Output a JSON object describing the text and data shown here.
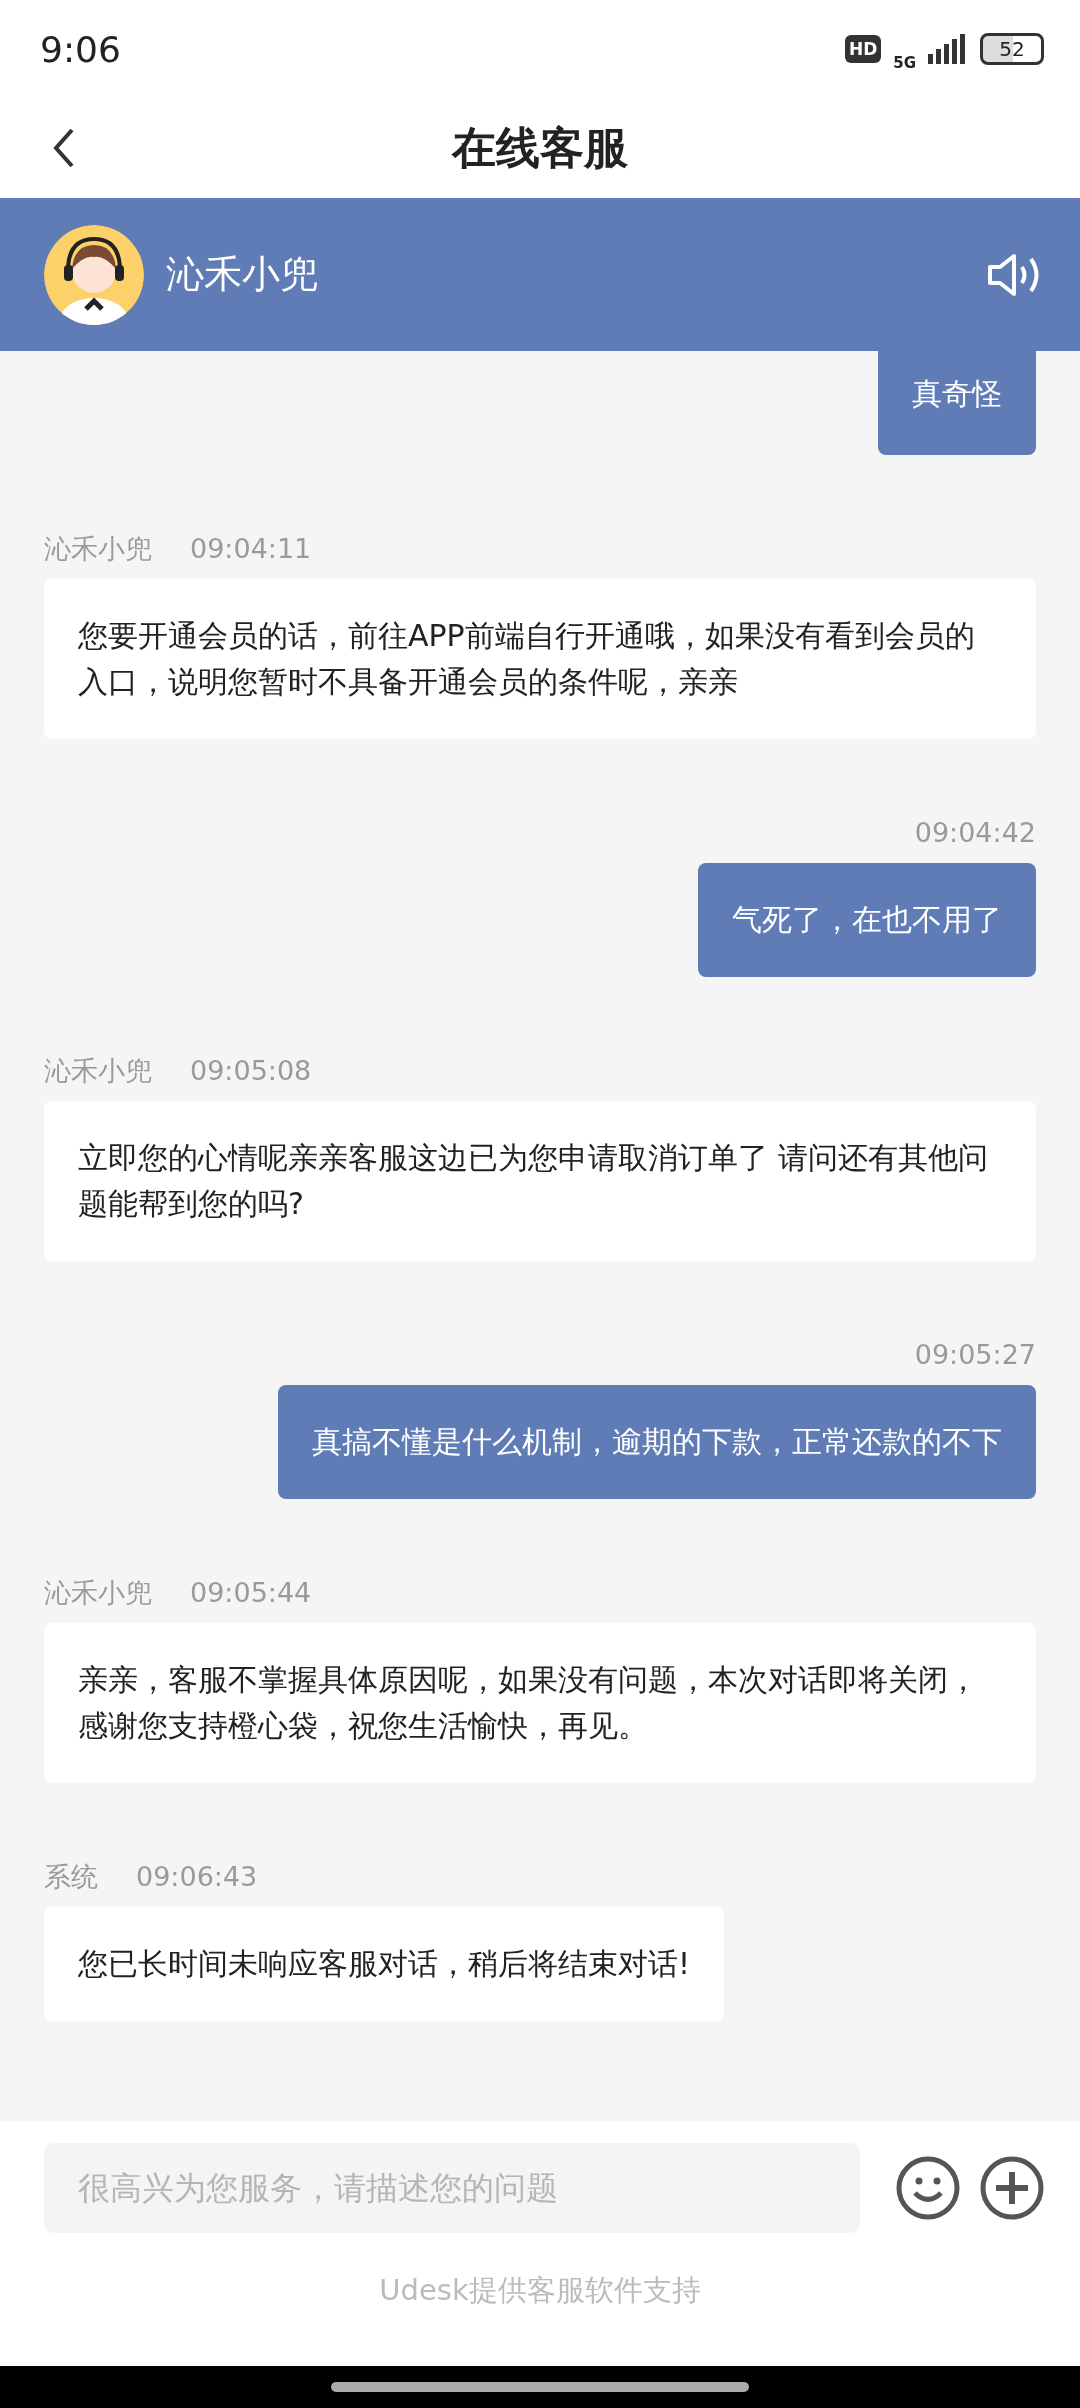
{
  "status_bar": {
    "time": "9:06",
    "hd": "HD",
    "network": "5G",
    "battery": "52"
  },
  "title_bar": {
    "title": "在线客服"
  },
  "agent_header": {
    "name": "沁禾小兜"
  },
  "messages": [
    {
      "kind": "user",
      "text": "真奇怪"
    },
    {
      "kind": "agent",
      "sender": "沁禾小兜",
      "time": "09:04:11",
      "text": "您要开通会员的话，前往APP前端自行开通哦，如果没有看到会员的入口，说明您暂时不具备开通会员的条件呢，亲亲"
    },
    {
      "kind": "user",
      "time": "09:04:42",
      "text": "气死了，在也不用了"
    },
    {
      "kind": "agent",
      "sender": "沁禾小兜",
      "time": "09:05:08",
      "text": "立即您的心情呢亲亲客服这边已为您申请取消订单了 请问还有其他问题能帮到您的吗?"
    },
    {
      "kind": "user",
      "time": "09:05:27",
      "text": "真搞不懂是什么机制，逾期的下款，正常还款的不下"
    },
    {
      "kind": "agent",
      "sender": "沁禾小兜",
      "time": "09:05:44",
      "text": "亲亲，客服不掌握具体原因呢，如果没有问题，本次对话即将关闭，感谢您支持橙心袋，祝您生活愉快，再见。"
    },
    {
      "kind": "agent",
      "sender": "系统",
      "time": "09:06:43",
      "text": "您已长时间未响应客服对话，稍后将结束对话!"
    }
  ],
  "composer": {
    "placeholder": "很高兴为您服务，请描述您的问题"
  },
  "footer": "Udesk提供客服软件支持"
}
